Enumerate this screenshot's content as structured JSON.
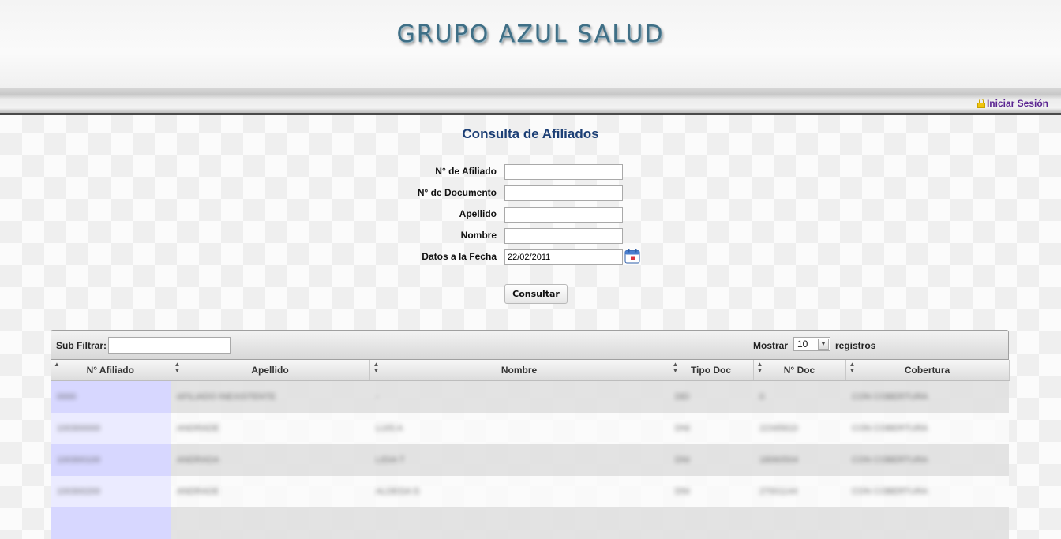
{
  "header": {
    "brand": "GRUPO AZUL SALUD"
  },
  "topbar": {
    "login_label": "Iniciar Sesión"
  },
  "page": {
    "title": "Consulta de Afiliados"
  },
  "form": {
    "afiliado_label": "N° de Afiliado",
    "documento_label": "N° de Documento",
    "apellido_label": "Apellido",
    "nombre_label": "Nombre",
    "fecha_label": "Datos a la Fecha",
    "fecha_value": "22/02/2011",
    "submit_label": "Consultar"
  },
  "table": {
    "subfilter_label": "Sub Filtrar:",
    "show_label": "Mostrar",
    "show_value": "10",
    "records_label": "registros",
    "columns": [
      "N° Afiliado",
      "Apellido",
      "Nombre",
      "Tipo Doc",
      "N° Doc",
      "Cobertura"
    ],
    "rows": [
      [
        "0000",
        "AFILIADO INEXISTENTE",
        "-",
        "DEI",
        "0",
        "CON COBERTURA"
      ],
      [
        "100300000",
        "ANDRADE",
        "LUIS A",
        "DNI",
        "22345610",
        "CON COBERTURA"
      ],
      [
        "100300100",
        "ANDRADA",
        "LIDIA T",
        "DNI",
        "18060504",
        "CON COBERTURA"
      ],
      [
        "100300200",
        "ANDRADE",
        "ALDEGA G",
        "DNI",
        "27001144",
        "CON COBERTURA"
      ]
    ]
  }
}
